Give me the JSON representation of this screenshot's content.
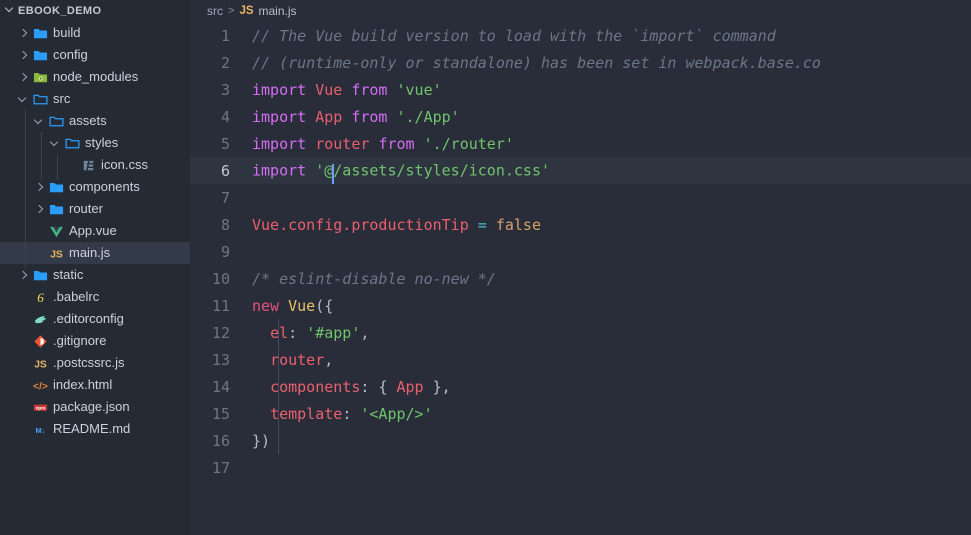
{
  "window": {
    "theme": "dark-vscode",
    "colors": {
      "sidebar_bg": "#252b35",
      "editor_bg": "#282d39",
      "active_line_bg": "#2e3440",
      "selected_row_bg": "#343b48",
      "accent_blue": "#4a9cf0",
      "cursor": "#6aa0f0"
    }
  },
  "sidebar": {
    "title": "EBOOK_DEMO",
    "title_twisty": "chevron-down",
    "items": [
      {
        "label": "build",
        "icon": "folder-blue",
        "indent": 1,
        "twisty": "right",
        "expanded": false,
        "selected": false
      },
      {
        "label": "config",
        "icon": "folder-blue",
        "indent": 1,
        "twisty": "right",
        "expanded": false,
        "selected": false
      },
      {
        "label": "node_modules",
        "icon": "folder-green",
        "indent": 1,
        "twisty": "right",
        "expanded": false,
        "selected": false
      },
      {
        "label": "src",
        "icon": "folder-open-blue",
        "indent": 1,
        "twisty": "down",
        "expanded": true,
        "selected": false
      },
      {
        "label": "assets",
        "icon": "folder-open-blue",
        "indent": 2,
        "twisty": "down",
        "expanded": true,
        "selected": false
      },
      {
        "label": "styles",
        "icon": "folder-open-blue",
        "indent": 3,
        "twisty": "down",
        "expanded": true,
        "selected": false
      },
      {
        "label": "icon.css",
        "icon": "css-icon",
        "indent": 4,
        "twisty": "none",
        "expanded": false,
        "selected": false
      },
      {
        "label": "components",
        "icon": "folder-blue",
        "indent": 2,
        "twisty": "right",
        "expanded": false,
        "selected": false
      },
      {
        "label": "router",
        "icon": "folder-blue",
        "indent": 2,
        "twisty": "right",
        "expanded": false,
        "selected": false
      },
      {
        "label": "App.vue",
        "icon": "vue-icon",
        "indent": 2,
        "twisty": "none",
        "expanded": false,
        "selected": false
      },
      {
        "label": "main.js",
        "icon": "js-icon",
        "indent": 2,
        "twisty": "none",
        "expanded": false,
        "selected": true
      },
      {
        "label": "static",
        "icon": "folder-blue",
        "indent": 1,
        "twisty": "right",
        "expanded": false,
        "selected": false
      },
      {
        "label": ".babelrc",
        "icon": "babel-icon",
        "indent": 1,
        "twisty": "none",
        "expanded": false,
        "selected": false
      },
      {
        "label": ".editorconfig",
        "icon": "editorconfig-icon",
        "indent": 1,
        "twisty": "none",
        "expanded": false,
        "selected": false
      },
      {
        "label": ".gitignore",
        "icon": "git-icon",
        "indent": 1,
        "twisty": "none",
        "expanded": false,
        "selected": false
      },
      {
        "label": ".postcssrc.js",
        "icon": "js-icon",
        "indent": 1,
        "twisty": "none",
        "expanded": false,
        "selected": false
      },
      {
        "label": "index.html",
        "icon": "html-icon",
        "indent": 1,
        "twisty": "none",
        "expanded": false,
        "selected": false
      },
      {
        "label": "package.json",
        "icon": "npm-icon",
        "indent": 1,
        "twisty": "none",
        "expanded": false,
        "selected": false
      },
      {
        "label": "README.md",
        "icon": "markdown-icon",
        "indent": 1,
        "twisty": "none",
        "expanded": false,
        "selected": false
      }
    ]
  },
  "breadcrumb": {
    "folder": "src",
    "separator": ">",
    "file_icon": "JS",
    "file": "main.js"
  },
  "editor": {
    "active_line": 6,
    "cursor": {
      "line": 6,
      "column": 10
    },
    "total_lines": 17,
    "lines": [
      {
        "n": 1,
        "text": "// The Vue build version to load with the `import` command"
      },
      {
        "n": 2,
        "text": "// (runtime-only or standalone) has been set in webpack.base.co"
      },
      {
        "n": 3,
        "text": "import Vue from 'vue'"
      },
      {
        "n": 4,
        "text": "import App from './App'"
      },
      {
        "n": 5,
        "text": "import router from './router'"
      },
      {
        "n": 6,
        "text": "import '@/assets/styles/icon.css'"
      },
      {
        "n": 7,
        "text": ""
      },
      {
        "n": 8,
        "text": "Vue.config.productionTip = false"
      },
      {
        "n": 9,
        "text": ""
      },
      {
        "n": 10,
        "text": "/* eslint-disable no-new */"
      },
      {
        "n": 11,
        "text": "new Vue({"
      },
      {
        "n": 12,
        "text": "  el: '#app',"
      },
      {
        "n": 13,
        "text": "  router,"
      },
      {
        "n": 14,
        "text": "  components: { App },"
      },
      {
        "n": 15,
        "text": "  template: '<App/>'"
      },
      {
        "n": 16,
        "text": "})"
      },
      {
        "n": 17,
        "text": ""
      }
    ],
    "line_numbers": [
      "1",
      "2",
      "3",
      "4",
      "5",
      "6",
      "7",
      "8",
      "9",
      "10",
      "11",
      "12",
      "13",
      "14",
      "15",
      "16",
      "17"
    ],
    "tokens": {
      "l1": {
        "comment": "// The Vue build version to load with the `import` command"
      },
      "l2": {
        "comment": "// (runtime-only or standalone) has been set in webpack.base.co"
      },
      "l3": {
        "kw": "import",
        "name": "Vue",
        "from": "from",
        "str": "'vue'"
      },
      "l4": {
        "kw": "import",
        "name": "App",
        "from": "from",
        "str": "'./App'"
      },
      "l5": {
        "kw": "import",
        "name": "router",
        "from": "from",
        "str": "'./router'"
      },
      "l6": {
        "kw": "import",
        "str_a": "'@",
        "str_b": "/assets/styles/icon.css'"
      },
      "l8": {
        "obj": "Vue.config.productionTip",
        "op": "=",
        "val": "false"
      },
      "l10": {
        "comment": "/* eslint-disable no-new */"
      },
      "l11": {
        "kw": "new",
        "cls": "Vue",
        "punc": "({"
      },
      "l12": {
        "prop": "el",
        "colon": ":",
        "str": "'#app'",
        "comma": ","
      },
      "l13": {
        "prop": "router",
        "comma": ","
      },
      "l14": {
        "prop": "components",
        "colon": ":",
        "open": "{",
        "val": "App",
        "close": "}",
        "comma": ","
      },
      "l15": {
        "prop": "template",
        "colon": ":",
        "str": "'<App/>'"
      },
      "l16": {
        "punc": "})"
      }
    }
  }
}
